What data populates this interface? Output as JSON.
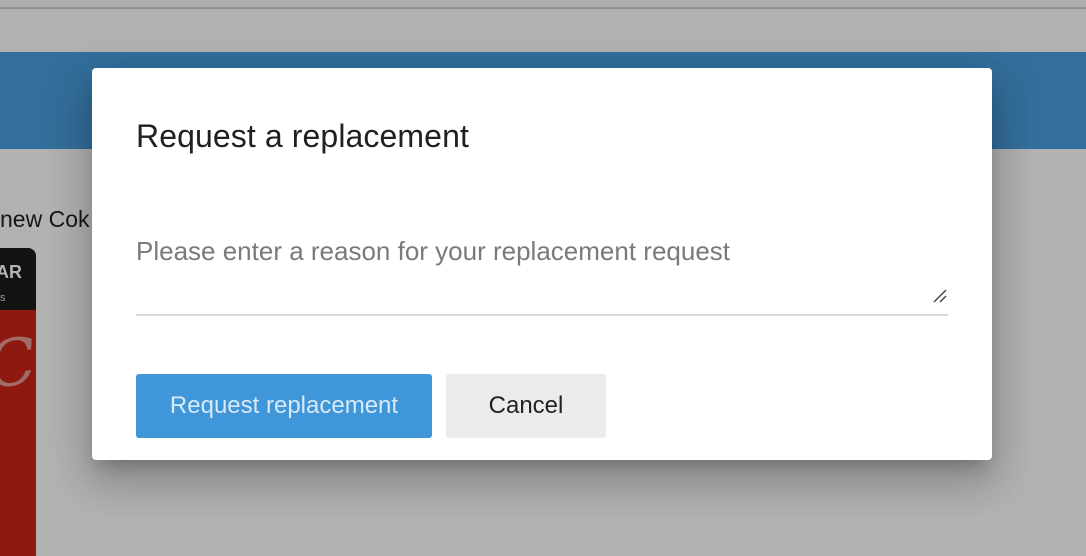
{
  "background": {
    "product_text": "new Cok",
    "can_top_text": "AR",
    "can_top_small": "s",
    "can_script": "Col"
  },
  "dialog": {
    "title": "Request a replacement",
    "reason_field": {
      "value": "",
      "placeholder": "Please enter a reason for your replacement request"
    },
    "primary_button": "Request replacement",
    "cancel_button": "Cancel"
  },
  "colors": {
    "app_bar": "#4a9fe0",
    "primary_button": "#3f96d8",
    "cancel_button": "#ebebeb"
  }
}
